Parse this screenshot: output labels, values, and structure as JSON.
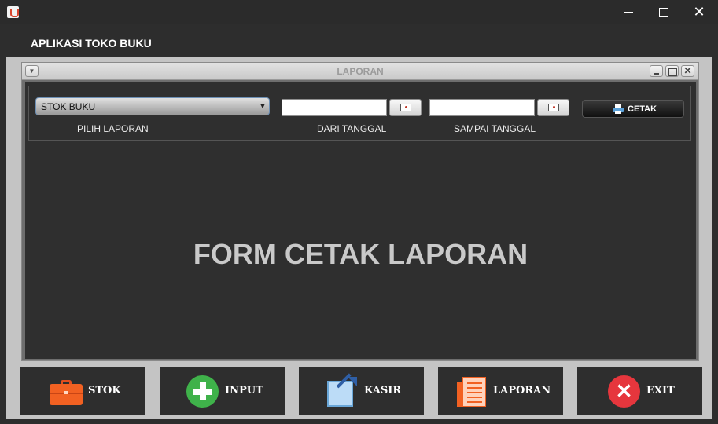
{
  "window": {
    "app_title": "APLIKASI TOKO BUKU",
    "minimize_glyph": "",
    "maximize_glyph": "",
    "close_glyph": "✕"
  },
  "internal_frame": {
    "title": "LAPORAN",
    "menu_glyph": "▼",
    "close_glyph": "✕"
  },
  "form": {
    "report_type_selected": "STOK BUKU",
    "report_type_label": "PILIH LAPORAN",
    "combo_arrow": "▼",
    "from_date_value": "",
    "from_date_label": "DARI TANGGAL",
    "to_date_value": "",
    "to_date_label": "SAMPAI TANGGAL",
    "print_label": "CETAK",
    "heading": "FORM CETAK LAPORAN"
  },
  "nav": {
    "stok": "STOK",
    "input": "INPUT",
    "kasir": "KASIR",
    "laporan": "LAPORAN",
    "exit": "EXIT",
    "exit_glyph": "✕"
  },
  "icons": {
    "app": "java-cup-icon",
    "stok": "briefcase-icon",
    "input": "plus-circle-icon",
    "kasir": "share-arrow-icon",
    "laporan": "report-document-icon",
    "exit": "close-circle-icon",
    "print": "printer-icon",
    "date": "calendar-icon"
  },
  "colors": {
    "background": "#2d2d2d",
    "desktop": "#c4c4c4",
    "stok_accent": "#f26122",
    "input_accent": "#3fb24a",
    "exit_accent": "#e6363d",
    "kasir_accent": "#2f5fa6"
  }
}
